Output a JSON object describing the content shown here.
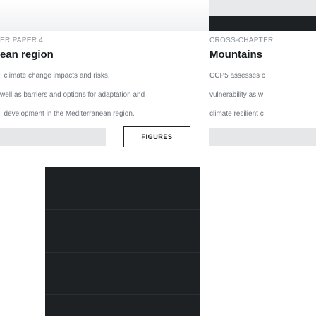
{
  "left": {
    "eyebrow": "ER PAPER 4",
    "heading": "ean region",
    "paragraph_lines": [
      ": climate change impacts and risks,",
      "well as barriers and options for adaptation and",
      ": development in the Mediterranean region."
    ],
    "figures_button": "FIGURES"
  },
  "right": {
    "eyebrow": "CROSS-CHAPTER",
    "heading": "Mountains",
    "paragraph_lines": [
      "CCP5 assesses c",
      "vulnerability as w",
      "climate resilient c"
    ]
  }
}
